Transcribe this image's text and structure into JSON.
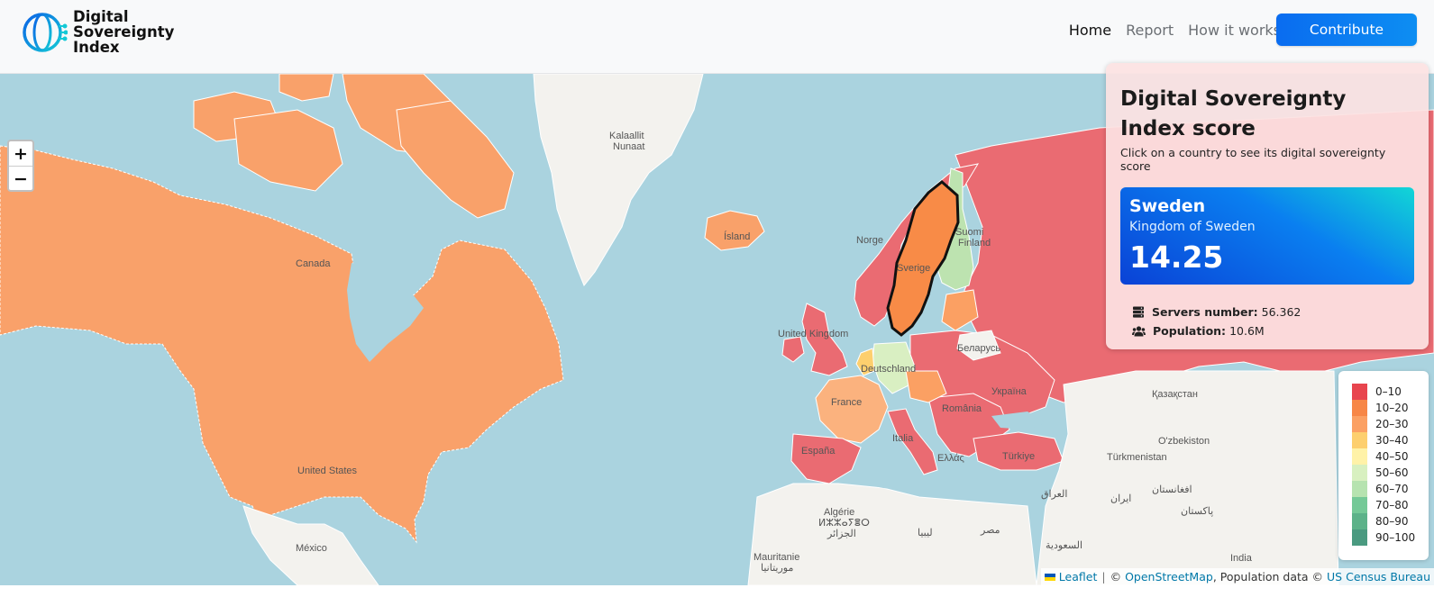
{
  "header": {
    "logo_lines": [
      "Digital",
      "Sovereignty",
      "Index"
    ],
    "nav": [
      {
        "label": "Home",
        "active": true
      },
      {
        "label": "Report",
        "active": false
      },
      {
        "label": "How it works",
        "active": false
      }
    ],
    "contribute_label": "Contribute"
  },
  "zoom": {
    "in": "+",
    "out": "−"
  },
  "panel": {
    "title": "Digital Sovereignty Index score",
    "subtitle": "Click on a country to see its digital sovereignty score",
    "selected": {
      "name": "Sweden",
      "full_name": "Kingdom of Sweden",
      "score": "14.25"
    },
    "servers_label": "Servers number:",
    "servers_value": "56.362",
    "population_label": "Population:",
    "population_value": "10.6M"
  },
  "legend": [
    {
      "label": "0–10",
      "color": "#e8454e"
    },
    {
      "label": "10–20",
      "color": "#f78646"
    },
    {
      "label": "20–30",
      "color": "#fba063"
    },
    {
      "label": "30–40",
      "color": "#fdcf6e"
    },
    {
      "label": "40–50",
      "color": "#fff2a8"
    },
    {
      "label": "50–60",
      "color": "#d8f0c0"
    },
    {
      "label": "60–70",
      "color": "#b6e3b0"
    },
    {
      "label": "70–80",
      "color": "#74c997"
    },
    {
      "label": "80–90",
      "color": "#5cb289"
    },
    {
      "label": "90–100",
      "color": "#4a9a80"
    }
  ],
  "map_labels": {
    "greenland": [
      "Kalaallit",
      "Nunaat"
    ],
    "iceland": "Ísland",
    "canada": "Canada",
    "united_states": "United States",
    "mexico": "México",
    "norway": "Norge",
    "sweden": "Sverige",
    "finland": [
      "Suomi",
      "Finland"
    ],
    "united_kingdom": "United Kingdom",
    "belarus": "Беларусь",
    "germany": "Deutschland",
    "france": "France",
    "ukraine": "Україна",
    "romania": "România",
    "italy": "Italia",
    "spain": "España",
    "greece": "Ελλάς",
    "turkey": "Türkiye",
    "kazakhstan": "Қазақстан",
    "uzbekistan": "O'zbekiston",
    "turkmenistan": "Türkmenistan",
    "algeria": [
      "Algérie",
      "ⵍⵣⵣⴰⵢⴻⵔ",
      "الجزائر"
    ],
    "libya": "ليبيا",
    "egypt": "مصر",
    "iraq": "العراق",
    "iran": "ایران",
    "afghanistan": "افغانستان",
    "pakistan": "پاکستان",
    "saudi": "السعودية",
    "india": "India",
    "mauritania": [
      "Mauritanie",
      "موريتانيا"
    ]
  },
  "score_colors": {
    "canada_us": "#f9a16a",
    "sweden": "#f88b47",
    "russia_norway": "#ea6b72",
    "finland": "#bde3b0",
    "germany": "#d9efc2",
    "france": "#fbb27e",
    "land": "#f3f2ee",
    "water": "#aad3df"
  },
  "attribution": {
    "leaflet": "Leaflet",
    "sep": "|",
    "copy": "©",
    "osm": "OpenStreetMap",
    "pop_text": ", Population data ©",
    "census": "US Census Bureau"
  }
}
